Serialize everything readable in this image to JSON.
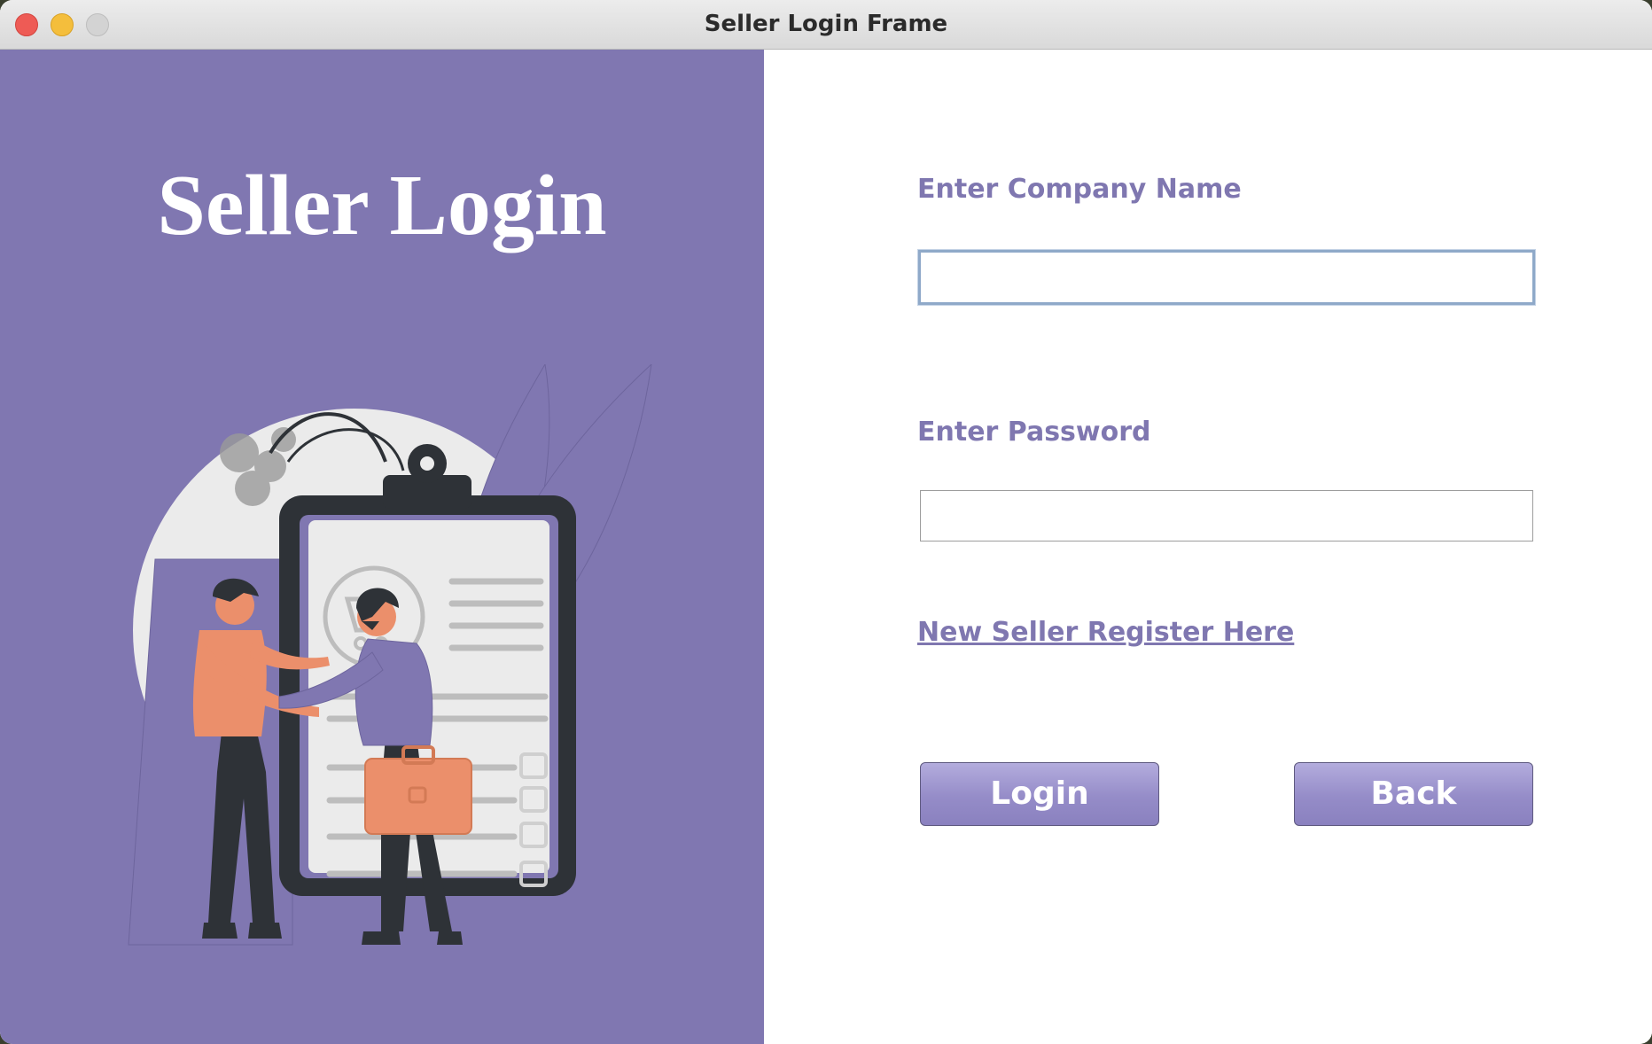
{
  "window": {
    "title": "Seller Login Frame"
  },
  "left_panel": {
    "heading": "Seller Login",
    "background_color": "#8077b1",
    "illustration": "handshake-shopping-clipboard-illustration"
  },
  "form": {
    "company_label": "Enter Company Name",
    "company_value": "",
    "password_label": "Enter Password",
    "password_value": "",
    "register_link": "New Seller Register Here",
    "login_button": "Login",
    "back_button": "Back"
  },
  "colors": {
    "accent": "#7f77b0",
    "button": "#958cc8"
  }
}
